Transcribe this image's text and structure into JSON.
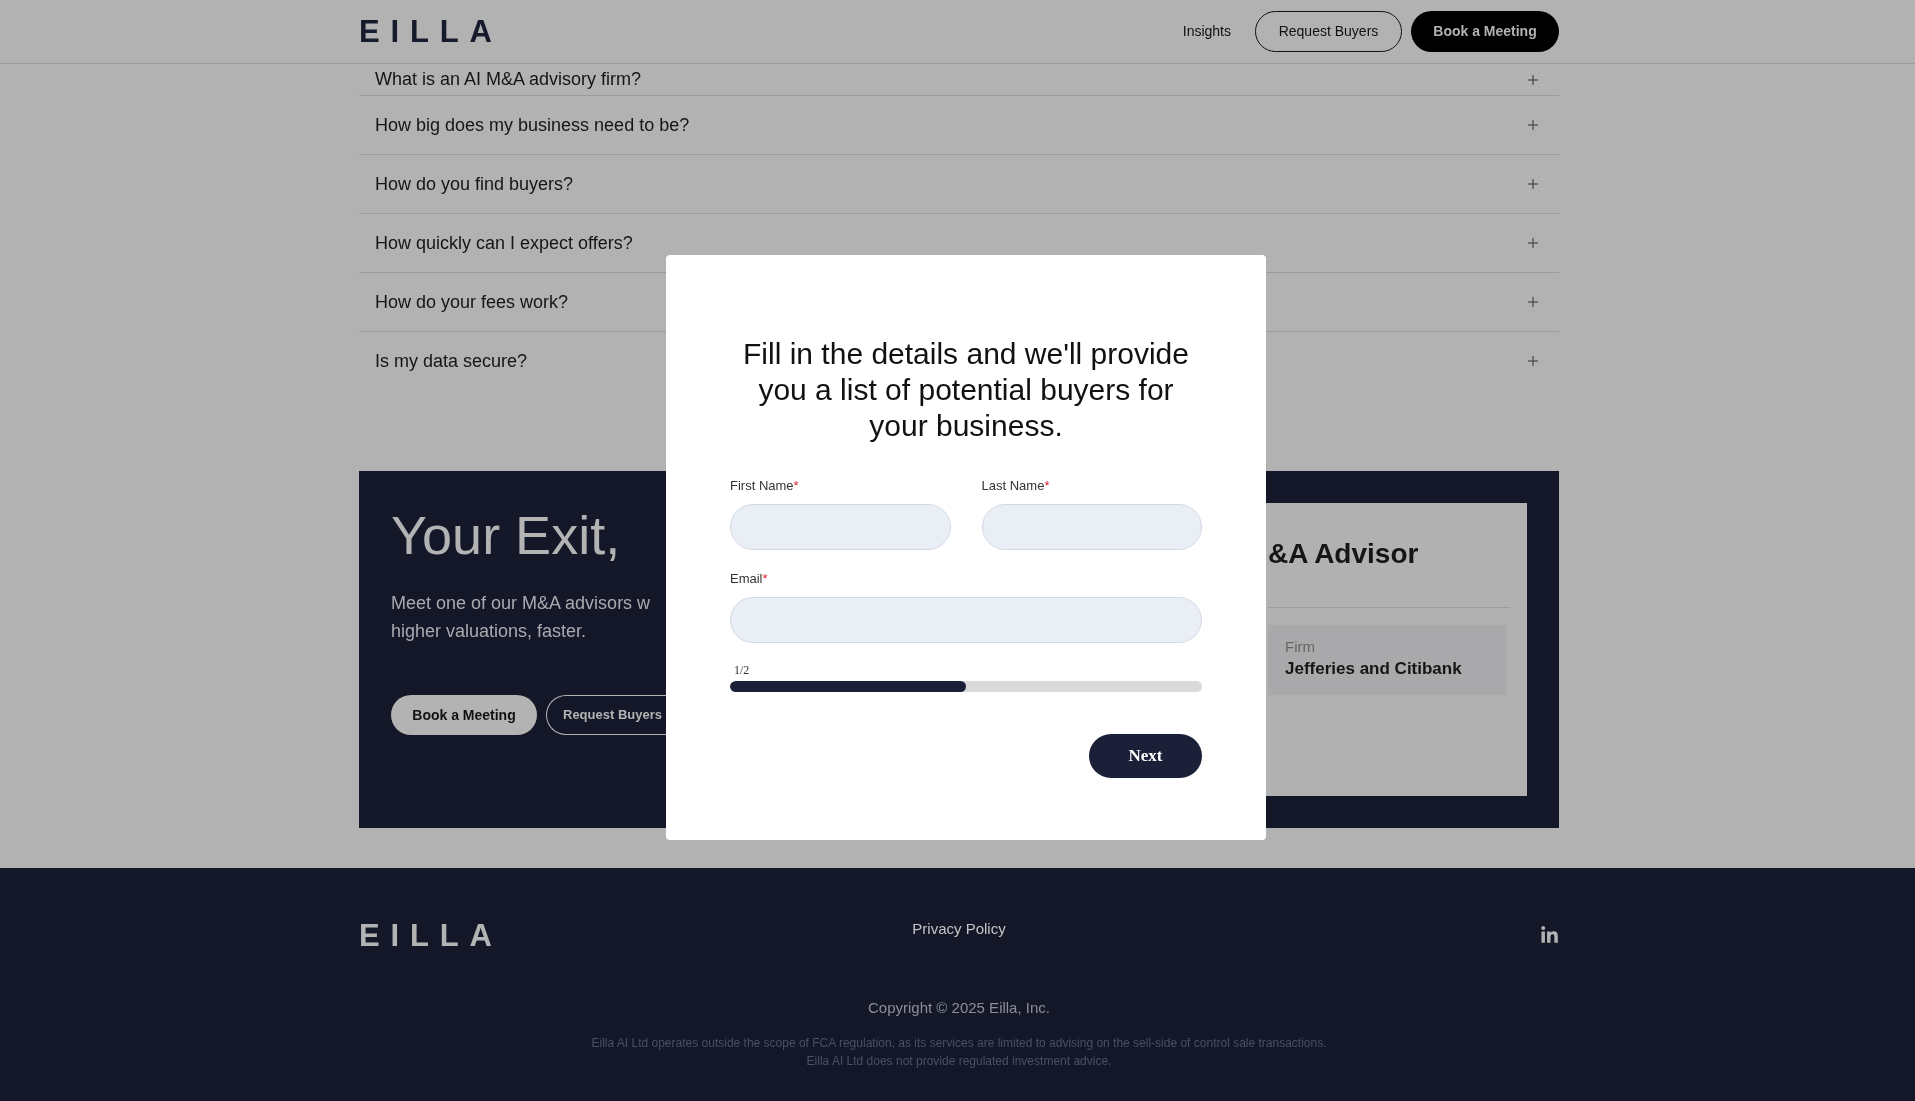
{
  "header": {
    "logo": "EILLA",
    "nav": [
      {
        "kind": "link",
        "label": "Insights"
      },
      {
        "kind": "outline",
        "label": "Request Buyers"
      },
      {
        "kind": "solid",
        "label": "Book a Meeting"
      }
    ]
  },
  "faq": [
    {
      "question": "What is an AI M&A advisory firm?",
      "expanded": false
    },
    {
      "question": "How big does my business need to be?",
      "expanded": false
    },
    {
      "question": "How do you find buyers?",
      "expanded": false
    },
    {
      "question": "How quickly can I expect offers?",
      "expanded": false
    },
    {
      "question": "How do your fees work?",
      "expanded": false
    },
    {
      "question": "Is my data secure?",
      "expanded": false
    }
  ],
  "cta": {
    "heading": "Your Exit,",
    "description_lines": [
      "Meet one of our M&A advisors w",
      "higher valuations, faster."
    ],
    "buttons": [
      {
        "kind": "solid",
        "label": "Book a Meeting"
      },
      {
        "kind": "outline",
        "label": "Request Buyers"
      }
    ],
    "card": {
      "title": "&A Advisor",
      "fields": [
        {
          "label": "Firm",
          "value": "Jefferies and Citibank"
        }
      ]
    }
  },
  "modal": {
    "heading": "Fill in the details and we'll provide you a list of potential buyers for your business.",
    "field_rows": [
      [
        {
          "label": "First Name",
          "required_mark": "*"
        },
        {
          "label": "Last Name",
          "required_mark": "*"
        }
      ],
      [
        {
          "label": "Email",
          "required_mark": "*"
        }
      ]
    ],
    "step": "1/2",
    "progress": {
      "level": 0.5
    },
    "button": "Next"
  },
  "footer": {
    "logo": "EILLA",
    "links": [
      "Privacy Policy"
    ],
    "copyright": "Copyright © 2025 Eilla, Inc.",
    "disclaimer_lines": [
      "Eilla AI Ltd operates outside the scope of FCA regulation, as its services are limited to advising on the sell-side of control sale transactions.",
      "Eilla AI Ltd does not provide regulated investment advice."
    ]
  }
}
